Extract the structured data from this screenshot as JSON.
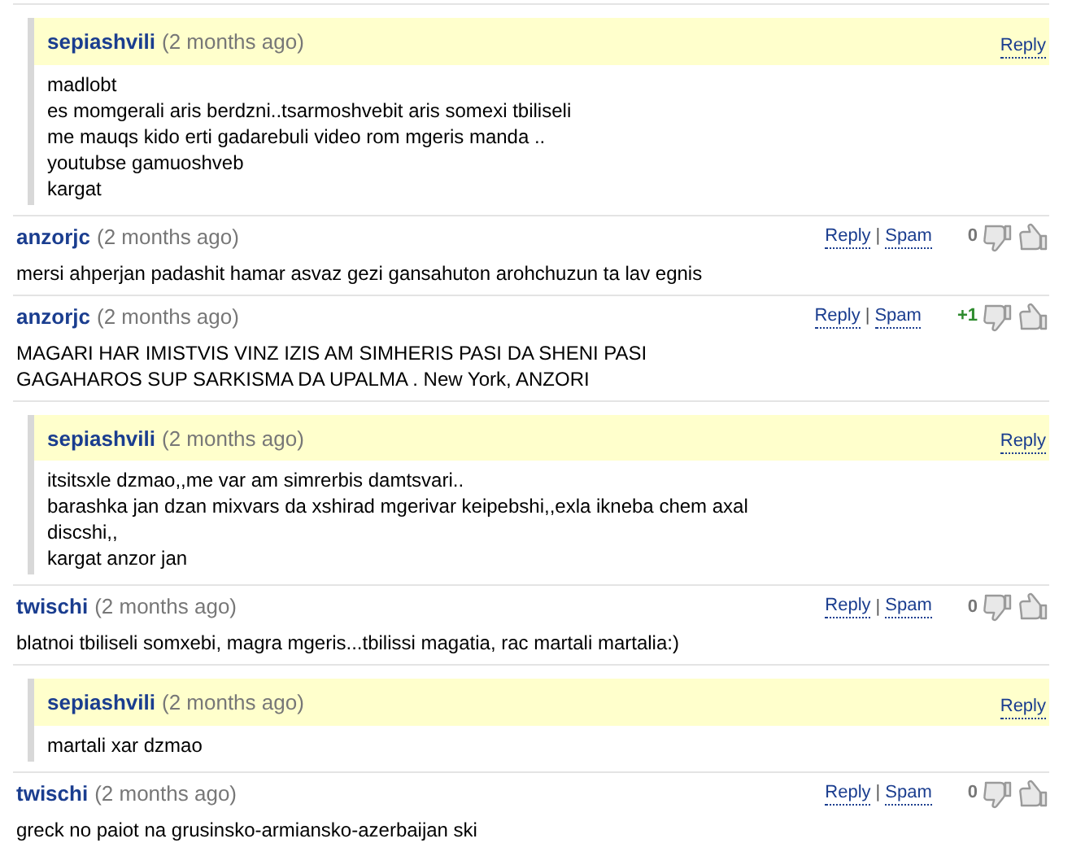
{
  "comments": [
    {
      "kind": "reply",
      "author": "sepiashvili",
      "time": "(2 months ago)",
      "reply": "Reply",
      "lines": [
        "madlobt",
        "es momgerali aris berdzni..tsarmoshvebit aris somexi tbiliseli",
        "me mauqs kido erti gadarebuli video rom mgeris manda ..",
        "youtubse gamuoshveb",
        "kargat"
      ]
    },
    {
      "kind": "comment",
      "author": "anzorjc",
      "time": "(2 months ago)",
      "reply": "Reply",
      "separator": "|",
      "spam": "Spam",
      "score": "0",
      "color": "#777777",
      "lines": [
        "mersi ahperjan padashit hamar asvaz gezi gansahuton arohchuzun ta lav egnis"
      ]
    },
    {
      "kind": "comment",
      "author": "anzorjc",
      "time": "(2 months ago)",
      "reply": "Reply",
      "separator": "|",
      "spam": "Spam",
      "score": "+1",
      "color": "#2e8b2e",
      "lines": [
        "MAGARI HAR IMISTVIS VINZ IZIS AM SIMHERIS PASI DA SHENI PASI",
        "GAGAHAROS SUP SARKISMA DA UPALMA . New York, ANZORI"
      ]
    },
    {
      "kind": "reply",
      "author": "sepiashvili",
      "time": "(2 months ago)",
      "reply": "Reply",
      "lines": [
        "itsitsxle dzmao,,me var am simrerbis damtsvari..",
        "barashka jan dzan mixvars da xshirad mgerivar keipebshi,,exla ikneba chem axal",
        "discshi,,",
        "kargat anzor jan"
      ]
    },
    {
      "kind": "comment",
      "author": "twischi",
      "time": "(2 months ago)",
      "reply": "Reply",
      "separator": "|",
      "spam": "Spam",
      "score": "0",
      "color": "#777777",
      "lines": [
        "blatnoi tbiliseli somxebi, magra mgeris...tbilissi magatia, rac martali martalia:)"
      ]
    },
    {
      "kind": "reply",
      "author": "sepiashvili",
      "time": "(2 months ago)",
      "reply": "Reply",
      "lines": [
        "martali xar dzmao"
      ]
    },
    {
      "kind": "comment",
      "author": "twischi",
      "time": "(2 months ago)",
      "reply": "Reply",
      "separator": "|",
      "spam": "Spam",
      "score": "0",
      "color": "#777777",
      "lines": [
        "greck no paiot na grusinsko-armiansko-azerbaijan ski"
      ]
    }
  ]
}
